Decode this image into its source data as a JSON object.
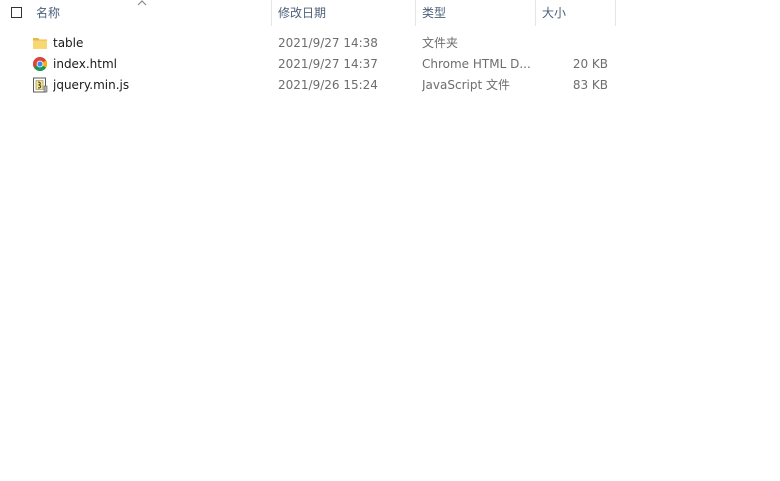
{
  "columns": {
    "name": "名称",
    "date": "修改日期",
    "type": "类型",
    "size": "大小"
  },
  "files": [
    {
      "name": "table",
      "date": "2021/9/27 14:38",
      "type": "文件夹",
      "size": "",
      "icon": "folder-icon"
    },
    {
      "name": "index.html",
      "date": "2021/9/27 14:37",
      "type": "Chrome HTML D...",
      "size": "20 KB",
      "icon": "chrome-icon"
    },
    {
      "name": "jquery.min.js",
      "date": "2021/9/26 15:24",
      "type": "JavaScript 文件",
      "size": "83 KB",
      "icon": "javascript-file-icon"
    }
  ],
  "colors": {
    "header_text": "#4c607a",
    "folder": "#f8d775",
    "muted_text": "#6d6d6d"
  }
}
